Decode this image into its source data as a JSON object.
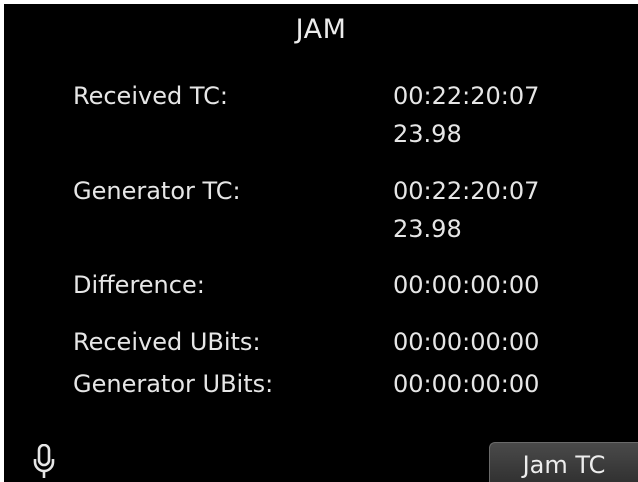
{
  "screen": {
    "title": "JAM"
  },
  "rows": {
    "received_tc": {
      "label": "Received TC:",
      "value": "00:22:20:07",
      "rate": "23.98"
    },
    "generator_tc": {
      "label": "Generator TC:",
      "value": "00:22:20:07",
      "rate": "23.98"
    },
    "difference": {
      "label": "Difference:",
      "value": "00:00:00:00"
    },
    "received_ubits": {
      "label": "Received UBits:",
      "value": "00:00:00:00"
    },
    "generator_ubits": {
      "label": "Generator UBits:",
      "value": "00:00:00:00"
    }
  },
  "footer": {
    "left_icon": "microphone-icon",
    "jam_button_label": "Jam TC"
  },
  "colors": {
    "background": "#000000",
    "text": "#e6e6e6",
    "button": "#3a3a3a"
  }
}
